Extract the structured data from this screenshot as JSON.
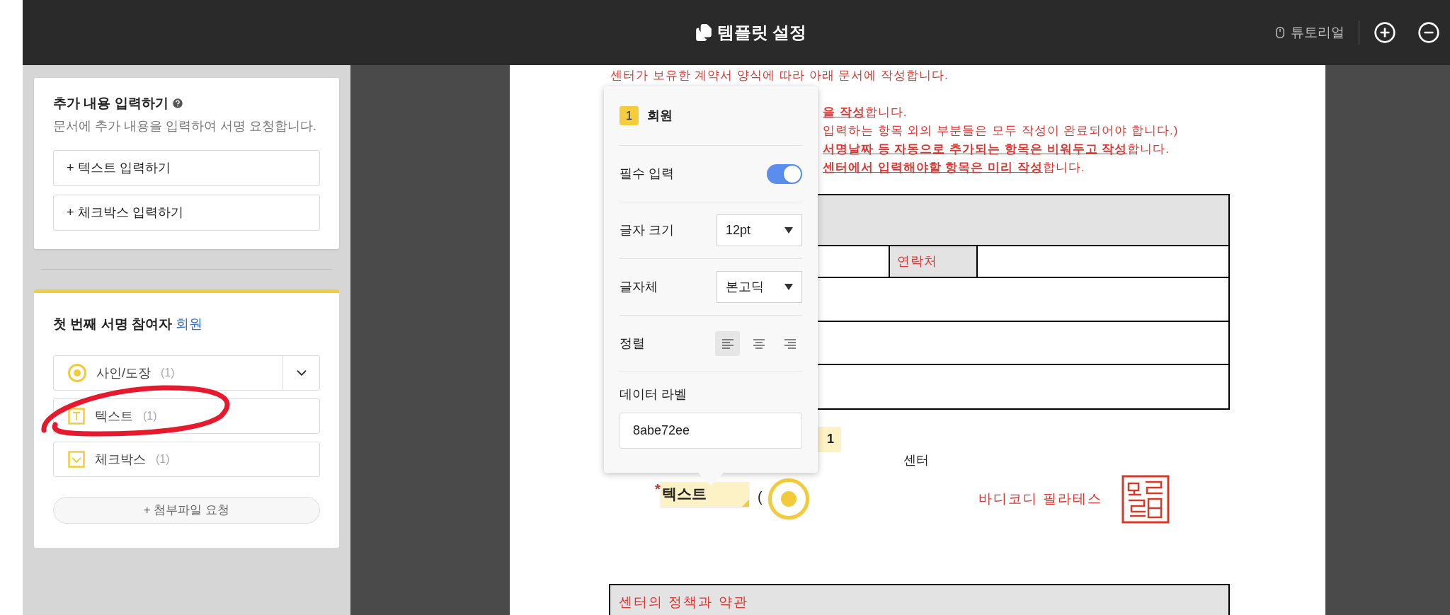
{
  "header": {
    "title": "템플릿 설정",
    "tutorial": "튜토리얼"
  },
  "sidebar": {
    "extra_card": {
      "title": "추가 내용 입력하기",
      "description": "문서에 추가 내용을 입력하여 서명 요청합니다.",
      "buttons": [
        "+ 텍스트 입력하기",
        "+ 체크박스 입력하기"
      ]
    },
    "signer_card": {
      "title": "첫 번째 서명 참여자",
      "role": "회원",
      "fields": [
        {
          "kind": "sign",
          "label": "사인/도장",
          "count": "(1)"
        },
        {
          "kind": "text",
          "label": "텍스트",
          "count": "(1)"
        },
        {
          "kind": "checkbox",
          "label": "체크박스",
          "count": "(1)"
        }
      ],
      "attach_button": "+ 첨부파일 요청"
    }
  },
  "popup": {
    "badge": "1",
    "title": "회원",
    "required": {
      "label": "필수 입력",
      "on": true
    },
    "font_size": {
      "label": "글자 크기",
      "value": "12pt"
    },
    "font": {
      "label": "글자체",
      "value": "본고딕"
    },
    "align": {
      "label": "정렬",
      "options": [
        {
          "kind": "left",
          "selected": true
        },
        {
          "kind": "center",
          "selected": false
        },
        {
          "kind": "right",
          "selected": false
        }
      ]
    },
    "data_label": {
      "label": "데이터 라벨",
      "value": "8abe72ee"
    }
  },
  "document": {
    "intro": "센터가 보유한 계약서 양식에 따라 아래 문서에 작성합니다.",
    "instructions": [
      "**을 작성**합니다.",
      "입력하는 항목 외의 부분들은 모두 작성이 완료되어야 합니다.)",
      "**서명날짜 등 자동으로 추가되는 항목은 비워두고 작성**합니다.",
      "**센터에서 입력해야할 항목은 미리 작성**합니다."
    ],
    "contact_label": "연락처",
    "tag": "1",
    "center_label": "센터",
    "text_field": {
      "required_mark": "*",
      "label": "텍스트"
    },
    "paren": "(",
    "center_name": "바디코디 필라테스",
    "policy_title": "센터의 정책과 약관"
  }
}
